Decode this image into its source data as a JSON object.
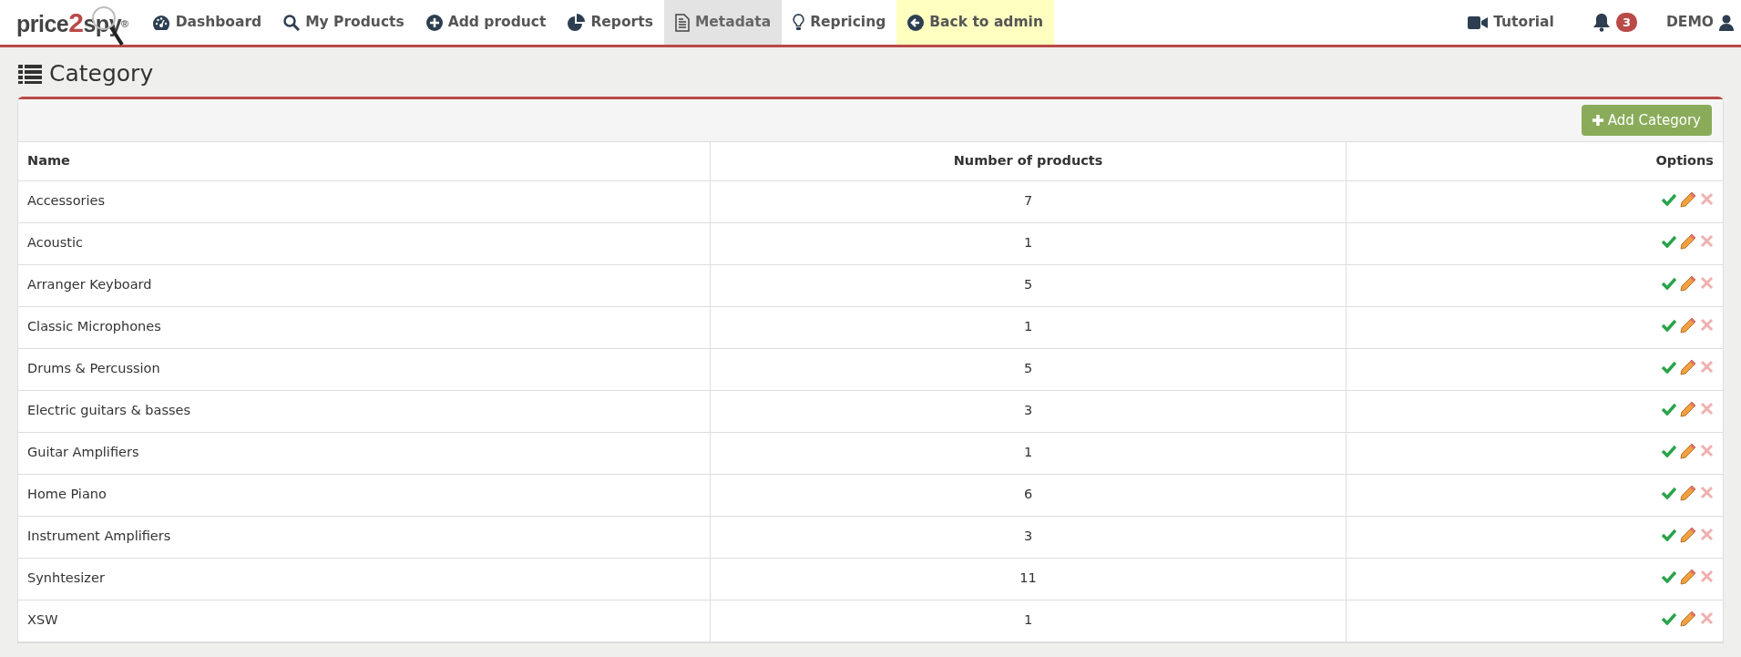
{
  "logo": {
    "parts": [
      "price",
      "2",
      "spy"
    ],
    "mark": "®"
  },
  "nav": [
    {
      "label": "Dashboard",
      "selected": false,
      "highlighted": false
    },
    {
      "label": "My Products",
      "selected": false,
      "highlighted": false
    },
    {
      "label": "Add product",
      "selected": false,
      "highlighted": false
    },
    {
      "label": "Reports",
      "selected": false,
      "highlighted": false
    },
    {
      "label": "Metadata",
      "selected": true,
      "highlighted": false
    },
    {
      "label": "Repricing",
      "selected": false,
      "highlighted": false
    },
    {
      "label": "Back to admin",
      "selected": false,
      "highlighted": true
    }
  ],
  "right_nav": {
    "tutorial": "Tutorial",
    "notifications": "3",
    "user": "DEMO"
  },
  "page_title": "Category",
  "add_button": "Add Category",
  "table": {
    "columns": [
      "Name",
      "Number of products",
      "Options"
    ],
    "rows": [
      {
        "name": "Accessories",
        "count": "7"
      },
      {
        "name": "Acoustic",
        "count": "1"
      },
      {
        "name": "Arranger Keyboard",
        "count": "5"
      },
      {
        "name": "Classic Microphones",
        "count": "1"
      },
      {
        "name": "Drums & Percussion",
        "count": "5"
      },
      {
        "name": "Electric guitars & basses",
        "count": "3"
      },
      {
        "name": "Guitar Amplifiers",
        "count": "1"
      },
      {
        "name": "Home Piano",
        "count": "6"
      },
      {
        "name": "Instrument Amplifiers",
        "count": "3"
      },
      {
        "name": "Synhtesizer",
        "count": "11"
      },
      {
        "name": "XSW",
        "count": "1"
      }
    ]
  }
}
